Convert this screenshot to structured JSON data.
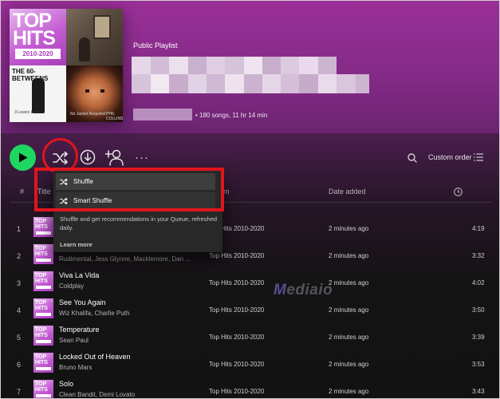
{
  "header": {
    "playlist_kind": "Public Playlist",
    "meta": "• 180 songs, 11 hr 14 min",
    "cover": {
      "top_hits_line1": "TOP",
      "top_hits_line2": "HITS",
      "top_hits_years": "2010-2020",
      "tile_60_title": "THE 60-BETWEENS",
      "tile_60_caption": "3 Lovers Lane",
      "tile_face_caption_left": "No Jacket Required",
      "tile_face_caption_right": "PHIL COLLINS"
    }
  },
  "toolbar": {
    "more_label": "···",
    "sort_label": "Custom order",
    "icons": [
      "play-icon",
      "shuffle-icon",
      "download-icon",
      "add-user-icon",
      "more-icon",
      "search-icon",
      "list-icon"
    ]
  },
  "table": {
    "headers": {
      "number": "#",
      "title": "Title",
      "album": "Album",
      "date_added": "Date added"
    },
    "rows": [
      {
        "number": "1",
        "title": "",
        "artist": "",
        "album": "Top Hits 2010-2020",
        "date": "2 minutes ago",
        "duration": "4:19"
      },
      {
        "number": "2",
        "title": "",
        "artist": "Rudimental, Jess Glynne, Macklemore, Dan ...",
        "album": "Top Hits 2010-2020",
        "date": "2 minutes ago",
        "duration": "3:32"
      },
      {
        "number": "3",
        "title": "Viva La Vida",
        "artist": "Coldplay",
        "album": "Top Hits 2010-2020",
        "date": "2 minutes ago",
        "duration": "4:02"
      },
      {
        "number": "4",
        "title": "See You Again",
        "artist": "Wiz Khalifa, Charlie Puth",
        "album": "Top Hits 2010-2020",
        "date": "2 minutes ago",
        "duration": "3:50"
      },
      {
        "number": "5",
        "title": "Temperature",
        "artist": "Sean Paul",
        "album": "Top Hits 2010-2020",
        "date": "2 minutes ago",
        "duration": "3:39"
      },
      {
        "number": "6",
        "title": "Locked Out of Heaven",
        "artist": "Bruno Mars",
        "album": "Top Hits 2010-2020",
        "date": "2 minutes ago",
        "duration": "3:53"
      },
      {
        "number": "7",
        "title": "Solo",
        "artist": "Clean Bandit, Demi Lovato",
        "album": "Top Hits 2010-2020",
        "date": "2 minutes ago",
        "duration": "3:43"
      }
    ],
    "thumb_text": "TOP HITS"
  },
  "shuffle_menu": {
    "items": [
      {
        "label": "Shuffle"
      },
      {
        "label": "Smart Shuffle"
      }
    ],
    "description": "Shuffle and get recommendations in your Queue, refreshed daily.",
    "learn_more": "Learn more"
  },
  "watermark": {
    "m": "M",
    "rest": "ediaio"
  },
  "colors": {
    "accent_green": "#1ed760",
    "annotation_red": "#e0151c",
    "header_purple": "#9a2f98"
  }
}
